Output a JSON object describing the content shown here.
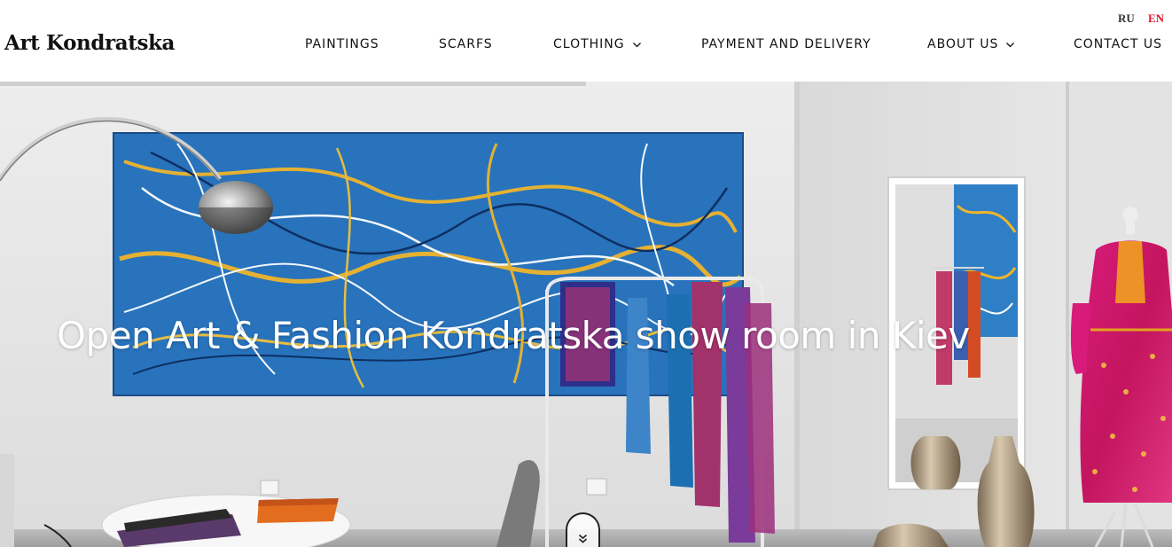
{
  "brand": {
    "name": "Art Kondratska"
  },
  "languages": [
    {
      "code": "RU",
      "active": false
    },
    {
      "code": "EN",
      "active": true
    }
  ],
  "nav": {
    "items": [
      {
        "label": "PAINTINGS",
        "has_dropdown": false
      },
      {
        "label": "SCARFS",
        "has_dropdown": false
      },
      {
        "label": "CLOTHING",
        "has_dropdown": true
      },
      {
        "label": "PAYMENT AND DELIVERY",
        "has_dropdown": false
      },
      {
        "label": "ABOUT US",
        "has_dropdown": true
      },
      {
        "label": "CONTACT US",
        "has_dropdown": false
      }
    ]
  },
  "hero": {
    "title": "Open Art & Fashion Kondratska show room in Kiev",
    "scroll_icon": "double-chevron-down-icon",
    "slider_progress": 0.5
  },
  "colors": {
    "accent": "#e0162b",
    "text": "#111111",
    "header_bg": "#ffffff"
  }
}
